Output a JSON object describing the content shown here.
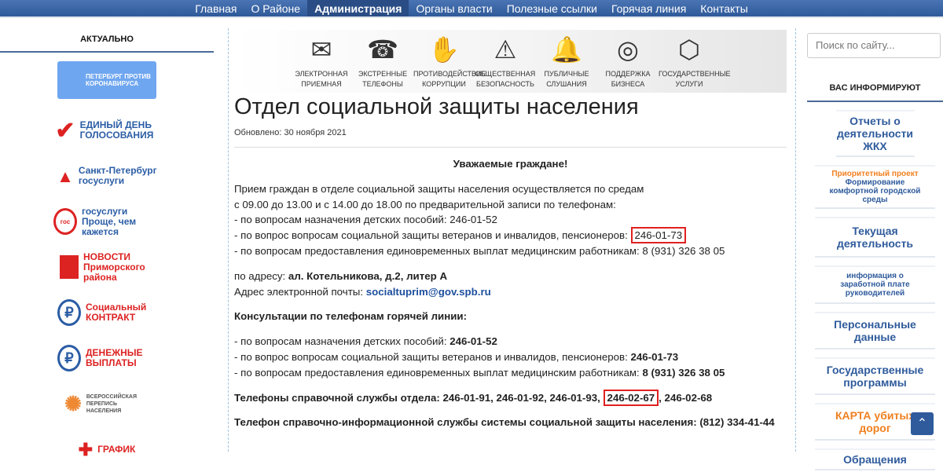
{
  "nav": [
    "Главная",
    "О Районе",
    "Администрация",
    "Органы власти",
    "Полезные ссылки",
    "Горячая линия",
    "Контакты"
  ],
  "left": {
    "title": "АКТУАЛЬНО",
    "logos": [
      "ПЕТЕРБУРГ ПРОТИВ КОРОНАВИРУСА",
      "ЕДИНЫЙ ДЕНЬ ГОЛОСОВАНИЯ",
      "Санкт-Петербург госуслуги",
      "госуслуги Проще, чем кажется",
      "НОВОСТИ Приморского района",
      "Социальный КОНТРАКТ",
      "ДЕНЕЖНЫЕ ВЫПЛАТЫ",
      "ВСЕРОССИЙСКАЯ ПЕРЕПИСЬ НАСЕЛЕНИЯ",
      "ГРАФИК"
    ]
  },
  "banner": [
    {
      "l1": "ЭЛЕКТРОННАЯ",
      "l2": "ПРИЕМНАЯ",
      "icon": "✉"
    },
    {
      "l1": "ЭКСТРЕННЫЕ",
      "l2": "ТЕЛЕФОНЫ",
      "icon": "☎"
    },
    {
      "l1": "ПРОТИВОДЕЙСТВИЕ",
      "l2": "КОРРУПЦИИ",
      "icon": "✋"
    },
    {
      "l1": "ОБЩЕСТВЕННАЯ",
      "l2": "БЕЗОПАСНОСТЬ",
      "icon": "⚠"
    },
    {
      "l1": "ПУБЛИЧНЫЕ",
      "l2": "СЛУШАНИЯ",
      "icon": "🔔"
    },
    {
      "l1": "ПОДДЕРЖКА",
      "l2": "БИЗНЕСА",
      "icon": "◎"
    },
    {
      "l1": "ГОСУДАРСТВЕННЫЕ",
      "l2": "УСЛУГИ",
      "icon": "⬡"
    }
  ],
  "page": {
    "title": "Отдел социальной защиты населения",
    "updated": "Обновлено: 30 ноября 2021",
    "greeting": "Уважаемые граждане!",
    "p1": "Прием граждан в отделе социальной защиты населения осуществляется по средам",
    "p2": "с 09.00 до 13.00 и с 14.00 до 18.00 по предварительной записи по телефонам:",
    "p3": "- по вопросам назначения детских пособий: 246-01-52",
    "p4": "- по вопрос вопросам социальной защиты ветеранов и инвалидов, пенсионеров:",
    "p4phone": "246-01-73",
    "p5": "- по вопросам предоставления единовременных выплат медицинским работникам: 8 (931) 326 38 05",
    "addr_label": "по адресу: ",
    "addr": "ал. Котельникова, д.2, литер А",
    "email_label": "Адрес электронной почты: ",
    "email": "socialtuprim@gov.spb.ru",
    "hot_title": "Консультации по телефонам горячей линии:",
    "h1": "- по вопросам назначения детских пособий: ",
    "h1p": "246-01-52",
    "h2": "- по вопрос вопросам социальной защиты ветеранов и инвалидов, пенсионеров: ",
    "h2p": "246-01-73",
    "h3": "- по вопросам предоставления единовременных выплат медицинским работникам: ",
    "h3p": "8 (931) 326 38 05",
    "ref": "Телефоны справочной службы отдела:  246-01-91, 246-01-92, 246-01-93,",
    "ref_box": "246-02-67",
    "ref_end": ", 246-02-68",
    "info": "Телефон справочно-информационной службы системы социальной защиты населения: (812) 334-41-44"
  },
  "right": {
    "search_placeholder": "Поиск по сайту...",
    "title": "ВАС ИНФОРМИРУЮТ",
    "items": [
      "Отчеты о деятельности ЖКХ",
      "Приоритетный проект",
      "Формирование комфортной городской среды",
      "Текущая деятельность",
      "информация о заработной плате руководителей",
      "Персональные данные",
      "Государственные программы",
      "КАРТА убитых дорог",
      "Обращения"
    ]
  }
}
